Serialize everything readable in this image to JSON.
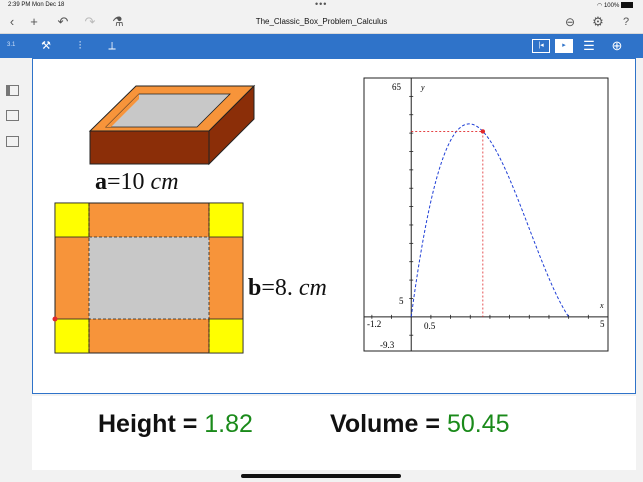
{
  "status": {
    "time": "2:39 PM  Mon Dec 18",
    "battery": "100%"
  },
  "titlebar": {
    "doc_title": "The_Classic_Box_Problem_Calculus"
  },
  "toolbar": {
    "page_number": "3.1"
  },
  "labels": {
    "a_name": "a",
    "a_value": "=10",
    "a_unit": "cm",
    "b_name": "b",
    "b_value": "=8.",
    "b_unit": "cm"
  },
  "graph": {
    "x_axis_label": "x",
    "y_axis_label": "y",
    "y_max_label": "65",
    "y_min_label": "-9.3",
    "x_min_label": "-1.2",
    "x_max_label": "5",
    "x_tick_label": "0.5",
    "y_tick_label": "5"
  },
  "results": {
    "height_label": "Height = ",
    "height_value": "1.82",
    "volume_label": "Volume = ",
    "volume_value": "50.45"
  },
  "colors": {
    "toolbar": "#2f73c9",
    "orange": "#f7943a",
    "yellow": "#ffff00",
    "box_brown": "#8b2e08",
    "gray": "#c8c8c8",
    "curve": "#1f3fd6",
    "guide": "#e0282b",
    "result_value": "#1a8a1a"
  }
}
